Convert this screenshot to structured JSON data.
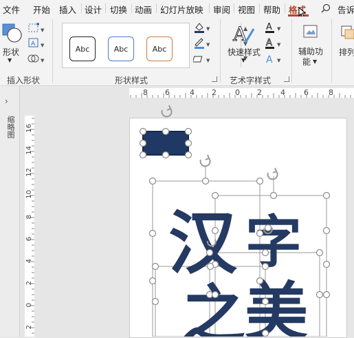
{
  "tabs": {
    "file": "文件",
    "home": "开始",
    "insert": "插入",
    "design": "设计",
    "transitions": "切换",
    "animations": "动画",
    "slideshow": "幻灯片放映",
    "review": "审阅",
    "view": "视图",
    "help": "帮助",
    "format": "格式",
    "tell_me": "告诉"
  },
  "ribbon": {
    "insert_shapes": {
      "shapes_label": "形状",
      "group_label": "插入形状"
    },
    "shape_styles": {
      "samples": [
        "Abc",
        "Abc",
        "Abc"
      ],
      "group_label": "形状样式"
    },
    "wordart": {
      "quick_styles_label": "快速样式",
      "group_label": "艺术字样式"
    },
    "accessibility": {
      "label_line1": "辅助功",
      "label_line2": "能"
    },
    "arrange": {
      "label": "排列"
    }
  },
  "left_pane": {
    "thumbnails_label": "缩略图"
  },
  "rulers": {
    "horizontal_ticks": [
      "8",
      "6",
      "4",
      "2",
      "0",
      "2",
      "4",
      "6",
      "8"
    ],
    "vertical_ticks": [
      "16",
      "14",
      "12",
      "10",
      "8",
      "6",
      "4",
      "2",
      "0",
      "2"
    ]
  },
  "slide": {
    "text": [
      "汉",
      "字",
      "之",
      "美"
    ]
  },
  "colors": {
    "accent": "#b5472a",
    "shape_fill": "#203864",
    "text_fill": "#253a63",
    "handle": "#9a9a9a"
  }
}
